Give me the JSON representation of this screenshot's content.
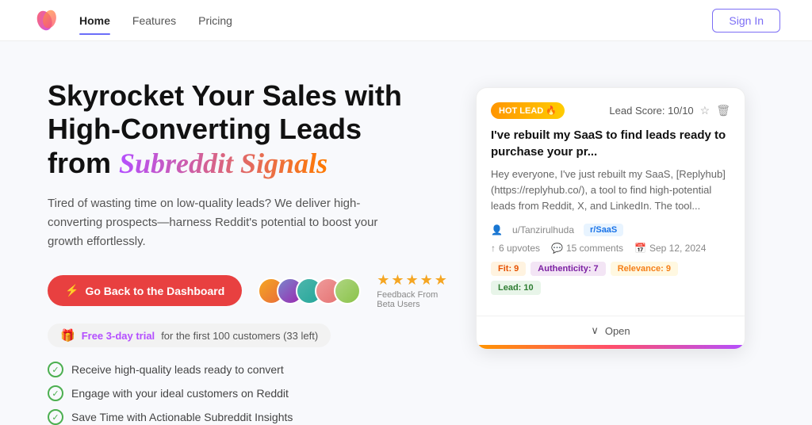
{
  "nav": {
    "links": [
      {
        "label": "Home",
        "active": true
      },
      {
        "label": "Features",
        "active": false
      },
      {
        "label": "Pricing",
        "active": false
      }
    ],
    "signin_label": "Sign In"
  },
  "hero": {
    "headline_part1": "Skyrocket Your Sales with High-Converting Leads from ",
    "headline_brand": "Subreddit Signals",
    "subtext": "Tired of wasting time on low-quality leads? We deliver high-converting prospects—harness Reddit's potential to boost your growth effortlessly.",
    "cta_label": "Go Back to the Dashboard",
    "feedback_label": "Feedback From Beta Users",
    "stars": "★★★★★",
    "trial_badge": " Free 3-day trial  for the first 100 customers (33 left)",
    "features": [
      "Receive high-quality leads ready to convert",
      "Engage with your ideal customers on Reddit",
      "Save Time with Actionable Subreddit Insights"
    ]
  },
  "card": {
    "hot_label": "HOT LEAD 🔥",
    "lead_score": "Lead Score: 10/10",
    "title": "I've rebuilt my SaaS to find leads ready to purchase your pr...",
    "body": "Hey everyone, I've just rebuilt my SaaS, [Replyhub](https://replyhub.co/), a tool to find high-potential leads from Reddit, X, and LinkedIn. The tool...",
    "author": "u/Tanzirulhuda",
    "subreddit": "r/SaaS",
    "upvotes": "6 upvotes",
    "comments": "15 comments",
    "date": "Sep 12, 2024",
    "scores": [
      {
        "label": "Fit: 9",
        "type": "fit"
      },
      {
        "label": "Authenticity: 7",
        "type": "auth"
      },
      {
        "label": "Relevance: 9",
        "type": "rel"
      },
      {
        "label": "Lead: 10",
        "type": "lead"
      }
    ],
    "open_label": "Open"
  }
}
